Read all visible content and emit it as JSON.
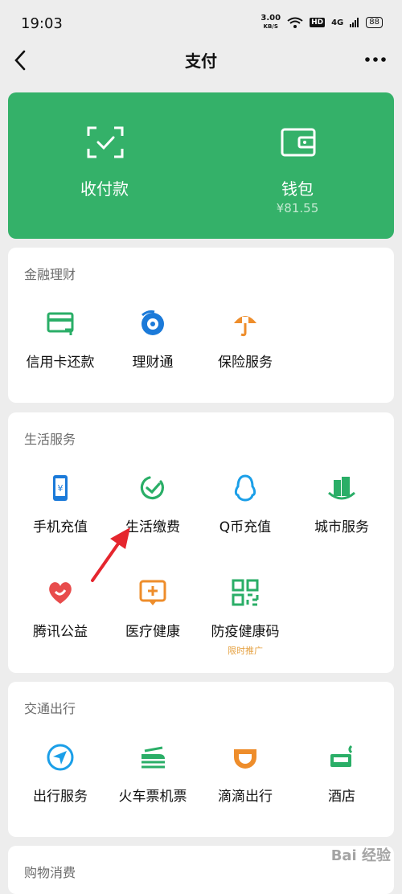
{
  "status": {
    "time": "19:03",
    "net_speed": "3.00",
    "net_unit": "KB/S",
    "hd": "HD",
    "signal": "4G",
    "battery": "88"
  },
  "nav": {
    "title": "支付"
  },
  "hero": {
    "pay_label": "收付款",
    "wallet_label": "钱包",
    "wallet_balance": "¥81.55",
    "color": "#34b169"
  },
  "finance": {
    "title": "金融理财",
    "items": [
      {
        "label": "信用卡还款"
      },
      {
        "label": "理财通"
      },
      {
        "label": "保险服务"
      }
    ]
  },
  "life": {
    "title": "生活服务",
    "items": [
      {
        "label": "手机充值"
      },
      {
        "label": "生活缴费"
      },
      {
        "label": "Q币充值"
      },
      {
        "label": "城市服务"
      },
      {
        "label": "腾讯公益"
      },
      {
        "label": "医疗健康"
      },
      {
        "label": "防疫健康码",
        "sub": "限时推广"
      }
    ]
  },
  "transport": {
    "title": "交通出行",
    "items": [
      {
        "label": "出行服务"
      },
      {
        "label": "火车票机票"
      },
      {
        "label": "滴滴出行"
      },
      {
        "label": "酒店"
      }
    ]
  },
  "shopping": {
    "title": "购物消费"
  },
  "watermark": "Bai 经验"
}
